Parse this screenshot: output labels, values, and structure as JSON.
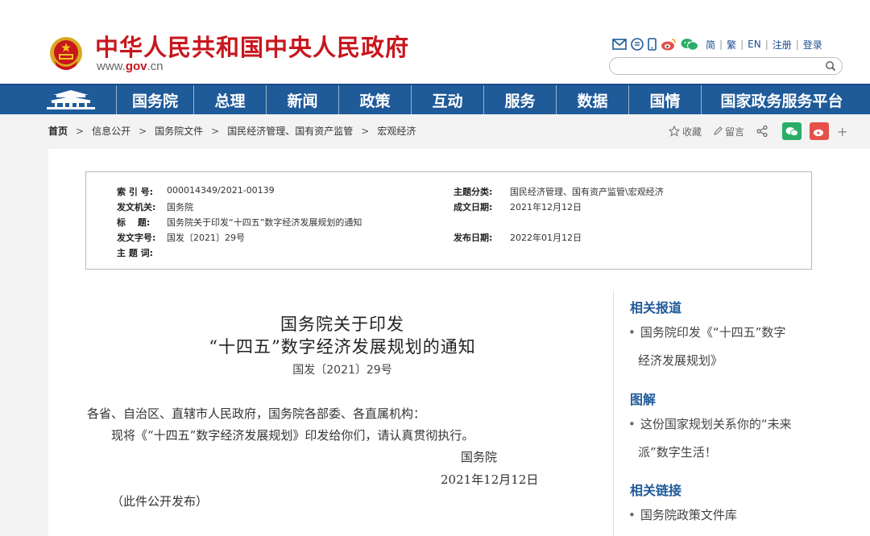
{
  "header": {
    "site_title": "中华人民共和国中央人民政府",
    "site_url_pre": "www.",
    "site_url_gov": "gov",
    "site_url_post": ".cn",
    "links": [
      "简",
      "繁",
      "EN",
      "注册",
      "登录"
    ],
    "search_placeholder": ""
  },
  "nav": {
    "items": [
      "国务院",
      "总理",
      "新闻",
      "政策",
      "互动",
      "服务",
      "数据",
      "国情",
      "国家政务服务平台"
    ]
  },
  "breadcrumb": {
    "items": [
      "首页",
      "信息公开",
      "国务院文件",
      "国民经济管理、国有资产监管",
      "宏观经济"
    ]
  },
  "share": {
    "collect": "收藏",
    "comment": "留言",
    "plus": "+"
  },
  "meta": {
    "index_key": "索 引 号:",
    "index_val": "000014349/2021-00139",
    "issuer_key": "发文机关:",
    "issuer_val": "国务院",
    "title_key": "标　 题:",
    "title_val": "国务院关于印发“十四五”数字经济发展规划的通知",
    "docno_key": "发文字号:",
    "docno_val": "国发〔2021〕29号",
    "subject_key": "主 题 词:",
    "subject_val": "",
    "category_key": "主题分类:",
    "category_val": "国民经济管理、国有资产监管\\宏观经济",
    "created_key": "成文日期:",
    "created_val": "2021年12月12日",
    "published_key": "发布日期:",
    "published_val": "2022年01月12日"
  },
  "doc": {
    "title_line1": "国务院关于印发",
    "title_line2": "“十四五”数字经济发展规划的通知",
    "number": "国发〔2021〕29号",
    "para1": "各省、自治区、直辖市人民政府，国务院各部委、各直属机构：",
    "para2": "现将《“十四五”数字经济发展规划》印发给你们，请认真贯彻执行。",
    "signature": "国务院",
    "date": "2021年12月12日",
    "note": "（此件公开发布）"
  },
  "sidebar": {
    "related_title": "相关报道",
    "related_line1": "国务院印发《“十四五”数字",
    "related_line2": "经济发展规划》",
    "graphic_title": "图解",
    "graphic_line1": "这份国家规划关系你的“未来",
    "graphic_line2": "派”数字生活！",
    "links_title": "相关链接",
    "links_item1": "国务院政策文件库"
  },
  "colors": {
    "brand_red": "#c8161d",
    "nav_blue": "#1f5a99",
    "wechat_green": "#2aae67",
    "weibo_red": "#e6504b"
  }
}
